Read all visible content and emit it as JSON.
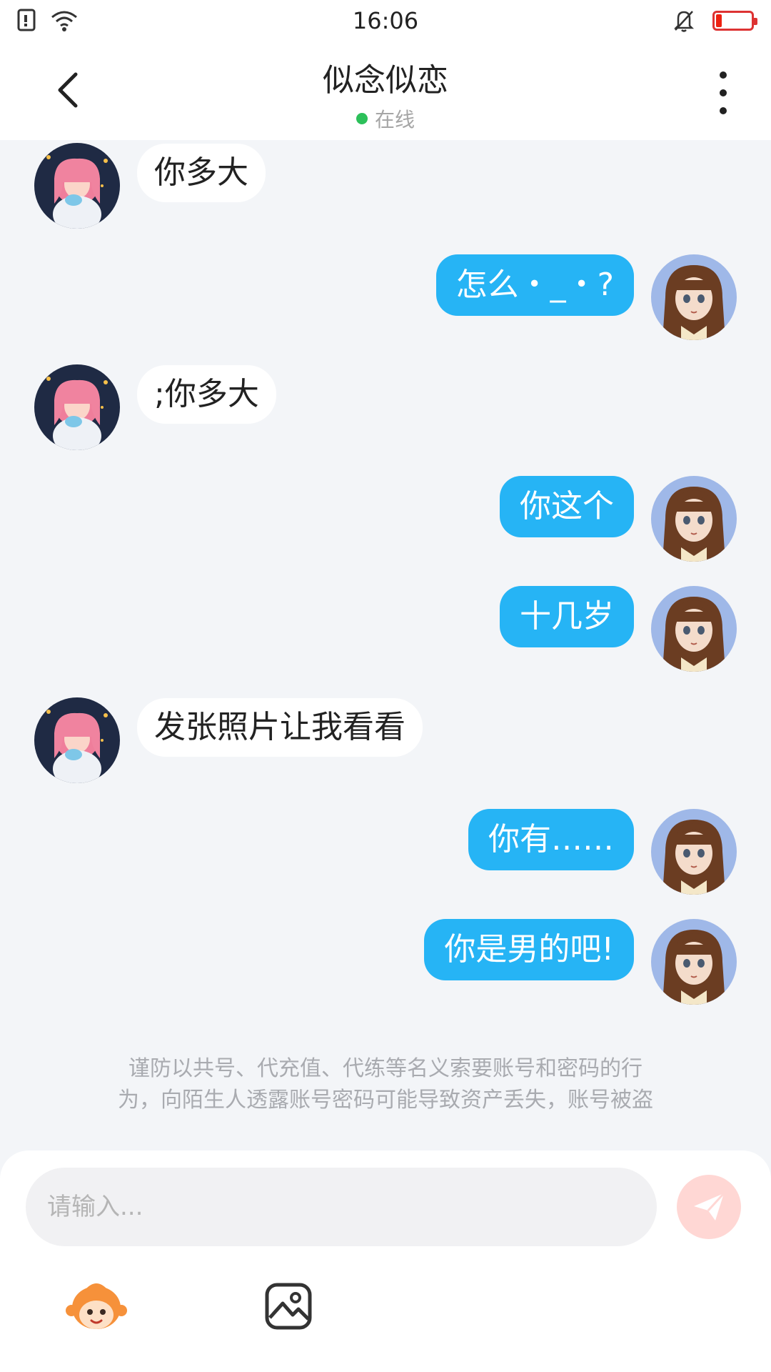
{
  "status_bar": {
    "time": "16:06"
  },
  "header": {
    "title": "似念似恋",
    "status": "在线"
  },
  "messages": [
    {
      "side": "in",
      "text": "你多大"
    },
    {
      "side": "out",
      "text": "怎么・_・?"
    },
    {
      "side": "in",
      "text": ";你多大"
    },
    {
      "side": "out",
      "text": "你这个"
    },
    {
      "side": "out",
      "text": "十几岁"
    },
    {
      "side": "in",
      "text": "发张照片让我看看"
    },
    {
      "side": "out",
      "text": "你有……"
    },
    {
      "side": "out",
      "text": "你是男的吧!"
    }
  ],
  "warning": {
    "line1": "谨防以共号、代充值、代练等名义索要账号和密码的行",
    "line2": "为，向陌生人透露账号密码可能导致资产丢失，账号被盗"
  },
  "input": {
    "placeholder": "请输入..."
  },
  "colors": {
    "accent": "#26b4f5",
    "online": "#2cc05a",
    "send": "#ffd7d4"
  }
}
